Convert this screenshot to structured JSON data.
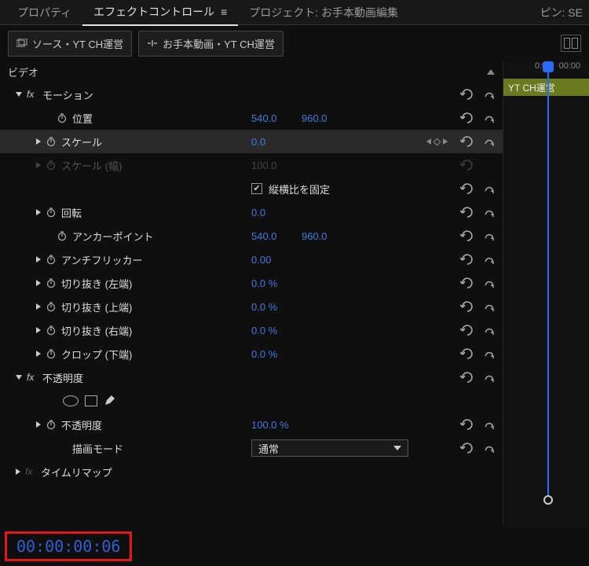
{
  "tabs": {
    "properties": "プロパティ",
    "effectControls": "エフェクトコントロール",
    "project": "プロジェクト: お手本動画編集",
    "pin": "ピン: SE"
  },
  "source": {
    "tab1": "ソース・YT CH運営",
    "tab2": "お手本動画・YT CH運営"
  },
  "ruler": {
    "t0": "0:00",
    "t1": "00:00"
  },
  "clip": {
    "name": "YT CH運営"
  },
  "video": {
    "header": "ビデオ",
    "motion": {
      "label": "モーション",
      "position": {
        "label": "位置",
        "x": "540.0",
        "y": "960.0"
      },
      "scale": {
        "label": "スケール",
        "value": "0.0"
      },
      "scaleW": {
        "label": "スケール (幅)",
        "value": "100.0"
      },
      "uniform": {
        "label": "縦横比を固定"
      },
      "rotation": {
        "label": "回転",
        "value": "0.0"
      },
      "anchor": {
        "label": "アンカーポイント",
        "x": "540.0",
        "y": "960.0"
      },
      "antiFlicker": {
        "label": "アンチフリッカー",
        "value": "0.00"
      },
      "cropL": {
        "label": "切り抜き (左端)",
        "value": "0.0 %"
      },
      "cropT": {
        "label": "切り抜き (上端)",
        "value": "0.0 %"
      },
      "cropR": {
        "label": "切り抜き (右端)",
        "value": "0.0 %"
      },
      "cropB": {
        "label": "クロップ (下端)",
        "value": "0.0 %"
      }
    },
    "opacity": {
      "label": "不透明度",
      "opacity": {
        "label": "不透明度",
        "value": "100.0 %"
      },
      "blend": {
        "label": "描画モード",
        "value": "通常"
      }
    },
    "timeRemap": {
      "label": "タイムリマップ"
    }
  },
  "timecode": "00:00:00:06"
}
